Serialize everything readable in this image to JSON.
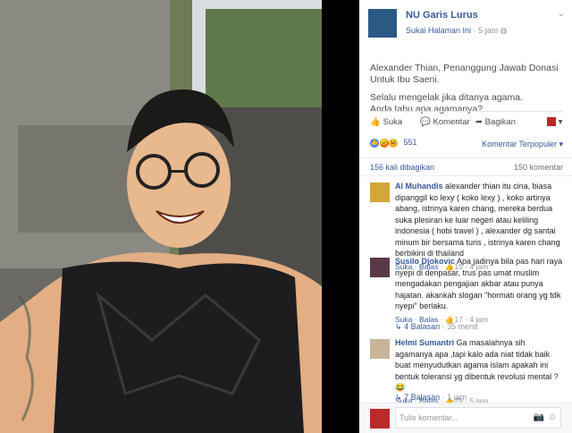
{
  "post": {
    "page_name": "NU Garis Lurus",
    "liked_page": "Sukai Halaman Ini",
    "time": "5 jam",
    "text_line1": "Alexander Thian, Penanggung Jawab Donasi Untuk Ibu Saeni.",
    "text_line2": "Selalu mengelak jika ditanya agama.",
    "text_line3": "Anda tahu apa agamanya?"
  },
  "actions": {
    "like": "Suka",
    "comment": "Komentar",
    "share": "Bagikan"
  },
  "stats": {
    "reactions": "551",
    "sort": "Komentar Terpopuler",
    "shares": "156 kali dibagikan",
    "comments": "150 komentar"
  },
  "comments": [
    {
      "name": "Al Muhandis",
      "text": "alexander thian itu cina, biasa dipanggil ko lexy ( koko lexy ) , koko artinya abang, istrinya karen chang, mereka berdua suka plesiran ke luar negeri atau keliling indonesia ( hobi travel ) , alexander dg santai minum bir bersama turis , istrinya karen chang berbikini di thailand",
      "like": "Suka",
      "reply": "Balas",
      "likes": "15",
      "time": "4 jam"
    },
    {
      "name": "Susilo Djokovic",
      "text": "Apa jadinya bila pas hari raya nyepi di denpasar, trus pas umat muslim mengadakan pengajian akbar atau punya hajatan. akankah slogan \"hormati orang yg tdk nyepi\" berlaku.",
      "like": "Suka",
      "reply": "Balas",
      "likes": "17",
      "time": "4 jam",
      "replies": "4 Balasan",
      "replies_time": "35 menit"
    },
    {
      "name": "Helmi Sumantri",
      "text": "Ga masalahnya sih agamanya apa ,tapi kalo ada niat tidak baik buat menyudutkan agama islam apakah ini bentuk toleransi yg dibentuk revolusi mental ? 😂",
      "like": "Suka",
      "reply": "Balas",
      "likes": "29",
      "time": "5 jam",
      "replies": "7 Balasan",
      "replies_time": "1 jam"
    }
  ],
  "composer": {
    "placeholder": "Tulis komentar..."
  }
}
